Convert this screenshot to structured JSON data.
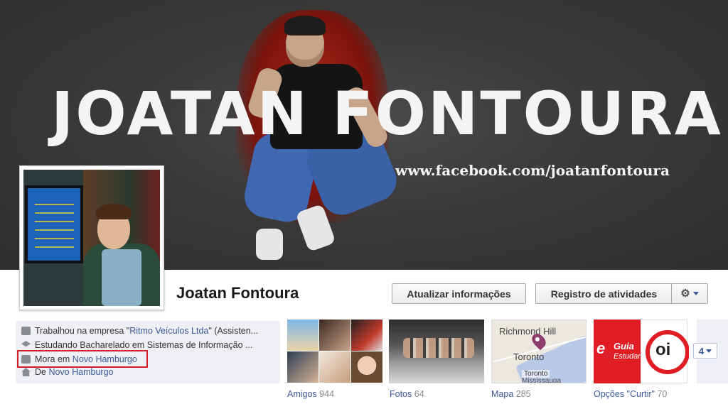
{
  "cover": {
    "title": "JOATAN FONTOURA",
    "url_text": "www.facebook.com/joatanfontoura"
  },
  "profile": {
    "name": "Joatan Fontoura"
  },
  "actions": {
    "update_info_label": "Atualizar informações",
    "activity_log_label": "Registro de atividades",
    "settings_icon": "gear-icon"
  },
  "info": {
    "work_prefix": "Trabalhou na empresa \"",
    "work_company": "Ritmo Veículos Ltda",
    "work_suffix": "\" (Assisten...",
    "study": "Estudando Bacharelado em Sistemas de Informação ...",
    "lives_prefix": "Mora em ",
    "lives_city": "Novo Hamburgo",
    "from_prefix": "De ",
    "from_city": "Novo Hamburgo",
    "highlight_color": "#d11f2a"
  },
  "tiles": {
    "friends_label": "Amigos",
    "friends_count": "944",
    "photos_label": "Fotos",
    "photos_count": "64",
    "map_label": "Mapa",
    "map_count": "285",
    "map_places": {
      "richmond_hill": "Richmond Hill",
      "toronto": "Toronto",
      "toronto_small": "Toronto",
      "mississauga": "Mississauga"
    },
    "likes_label": "Opções \"Curtir\"",
    "likes_count": "70",
    "like_logo_a": "e",
    "like_logo_a_word1": "Guia",
    "like_logo_a_word2": "Estudan",
    "like_logo_b": "oi"
  },
  "more": {
    "count": "4"
  },
  "colors": {
    "link": "#3b5998",
    "panel_bg": "#eef0f6",
    "brand_red": "#e01c24"
  }
}
